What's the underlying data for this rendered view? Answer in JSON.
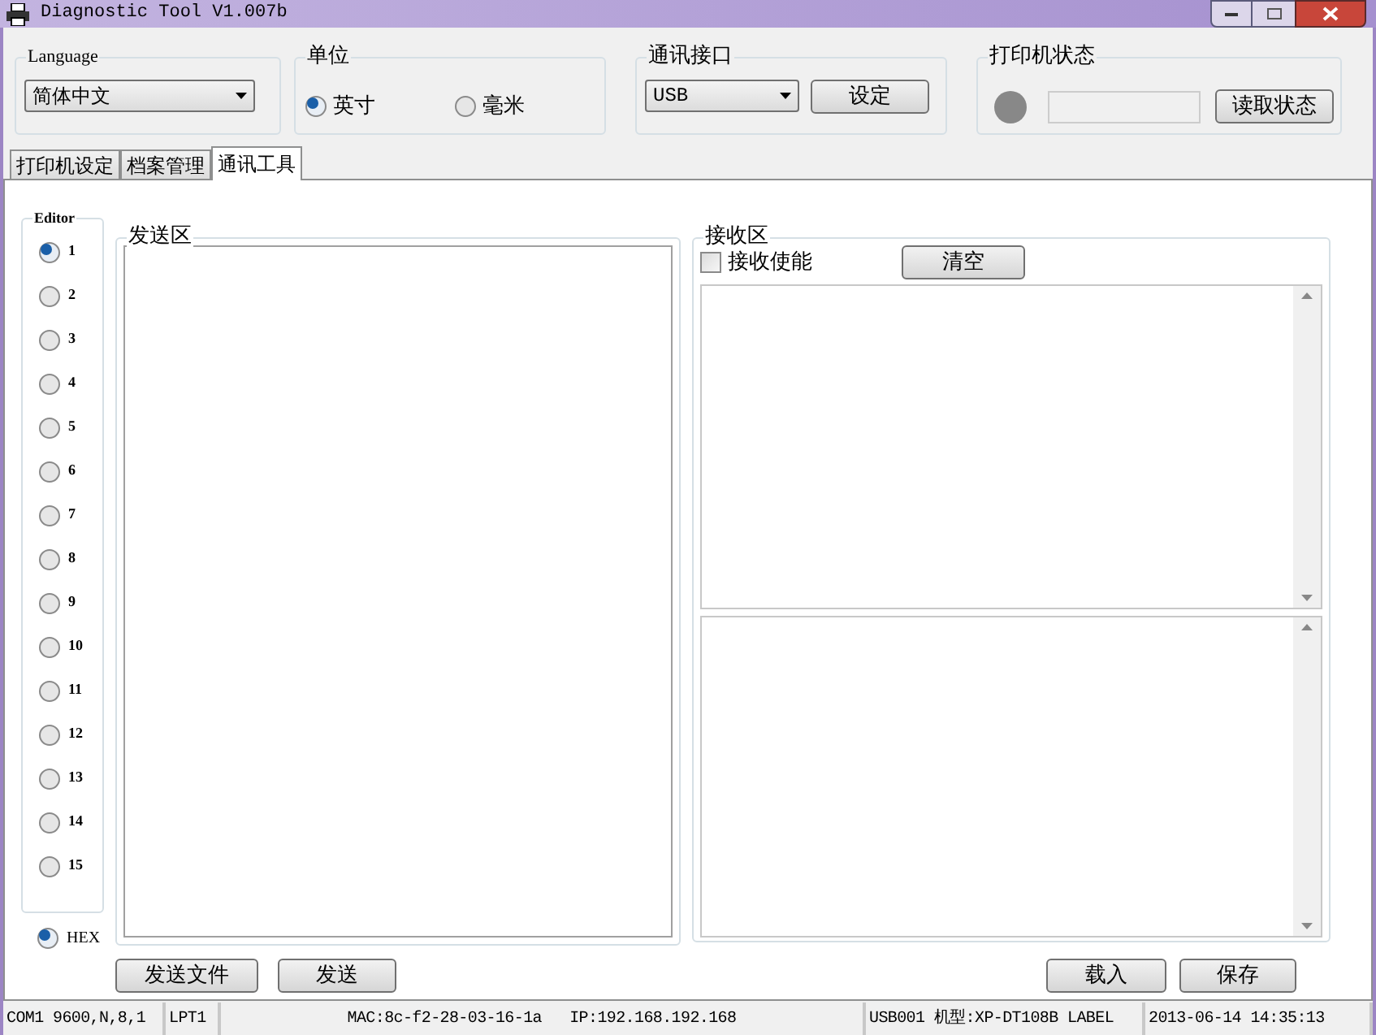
{
  "window": {
    "title": "Diagnostic Tool V1.007b"
  },
  "language": {
    "label": "Language",
    "value": "简体中文"
  },
  "unit": {
    "label": "单位",
    "options": [
      {
        "label": "英寸",
        "selected": true
      },
      {
        "label": "毫米",
        "selected": false
      }
    ]
  },
  "interface": {
    "label": "通讯接口",
    "value": "USB",
    "button": "设定"
  },
  "printer_status": {
    "label": "打印机状态",
    "button": "读取状态"
  },
  "tabs": [
    {
      "label": "打印机设定",
      "selected": false
    },
    {
      "label": "档案管理",
      "selected": false
    },
    {
      "label": "通讯工具",
      "selected": true
    }
  ],
  "editor": {
    "label": "Editor",
    "options": [
      {
        "label": "1",
        "selected": true
      },
      {
        "label": "2",
        "selected": false
      },
      {
        "label": "3",
        "selected": false
      },
      {
        "label": "4",
        "selected": false
      },
      {
        "label": "5",
        "selected": false
      },
      {
        "label": "6",
        "selected": false
      },
      {
        "label": "7",
        "selected": false
      },
      {
        "label": "8",
        "selected": false
      },
      {
        "label": "9",
        "selected": false
      },
      {
        "label": "10",
        "selected": false
      },
      {
        "label": "11",
        "selected": false
      },
      {
        "label": "12",
        "selected": false
      },
      {
        "label": "13",
        "selected": false
      },
      {
        "label": "14",
        "selected": false
      },
      {
        "label": "15",
        "selected": false
      }
    ],
    "hex": {
      "label": "HEX",
      "selected": true
    }
  },
  "send_area": {
    "label": "发送区",
    "buttons": [
      "发送文件",
      "发送"
    ]
  },
  "receive_area": {
    "label": "接收区",
    "enable": {
      "label": "接收使能",
      "checked": false
    },
    "clear_button": "清空",
    "buttons": [
      "载入",
      "保存"
    ]
  },
  "status_bar": [
    {
      "text": "COM1 9600,N,8,1"
    },
    {
      "text": "LPT1"
    },
    {
      "text": "MAC:8c-f2-28-03-16-1a   IP:192.168.192.168"
    },
    {
      "text": "USB001 机型:XP-DT108B LABEL"
    },
    {
      "text": "2013-06-14 14:35:13"
    }
  ]
}
